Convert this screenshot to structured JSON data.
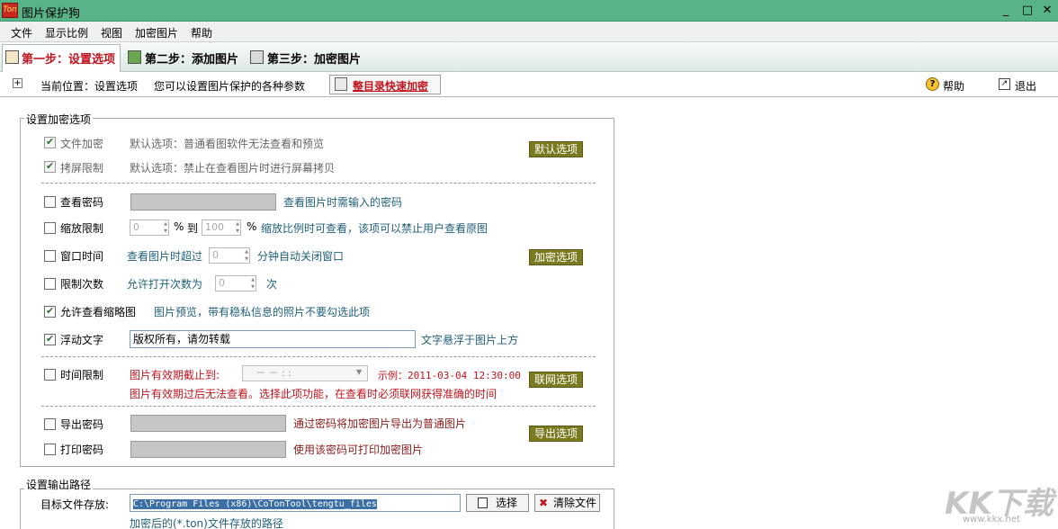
{
  "window": {
    "icon_text": "Ton",
    "title": "图片保护狗",
    "controls": [
      "_",
      "□",
      "✕"
    ]
  },
  "menu": [
    "文件",
    "显示比例",
    "视图",
    "加密图片",
    "帮助"
  ],
  "steps": [
    {
      "label": "第一步：设置选项",
      "active": true
    },
    {
      "label": "第二步：添加图片",
      "active": false
    },
    {
      "label": "第三步：加密图片",
      "active": false
    }
  ],
  "location": {
    "current": "当前位置：设置选项",
    "description": "您可以设置图片保护的各种参数",
    "whole_dir_button": "整目录快速加密",
    "help": "帮助",
    "exit": "退出"
  },
  "encrypt_group": {
    "legend": "设置加密选项",
    "file_encrypt": {
      "label": "文件加密",
      "checked": true,
      "desc": "默认选项：普通看图软件无法查看和预览"
    },
    "screen_limit": {
      "label": "拷屏限制",
      "checked": true,
      "desc": "默认选项：禁止在查看图片时进行屏幕拷贝"
    },
    "default_options_button": "默认选项",
    "view_password": {
      "label": "查看密码",
      "checked": false,
      "hint": "查看图片时需输入的密码"
    },
    "zoom_limit": {
      "label": "缩放限制",
      "checked": false,
      "from": "0",
      "percent": "%",
      "to_label": "到",
      "to": "100",
      "hint": "缩放比例时可查看，该项可以禁止用户查看原图"
    },
    "window_time": {
      "label": "窗口时间",
      "checked": false,
      "prefix": "查看图片时超过",
      "value": "0",
      "suffix": "分钟自动关闭窗口"
    },
    "encrypt_options_button": "加密选项",
    "limit_count": {
      "label": "限制次数",
      "checked": false,
      "prefix": "允许打开次数为",
      "value": "0",
      "suffix": "次"
    },
    "thumbnail": {
      "label": "允许查看缩略图",
      "checked": true,
      "hint": "图片预览，带有稳私信息的照片不要勾选此项"
    },
    "float_text": {
      "label": "浮动文字",
      "checked": true,
      "value": "版权所有，请勿转载",
      "hint": "文字悬浮于图片上方"
    },
    "time_limit": {
      "label": "时间限制",
      "checked": false,
      "prefix": "图片有效期截止到:",
      "date_value": "－ －      :   :",
      "example": "示例：2011-03-04 12:30:00",
      "note": "图片有效期过后无法查看。选择此项功能，在查看时必须联网获得准确的时间"
    },
    "network_options_button": "联网选项",
    "export_password": {
      "label": "导出密码",
      "checked": false,
      "hint": "通过密码将加密图片导出为普通图片"
    },
    "print_password": {
      "label": "打印密码",
      "checked": false,
      "hint": "使用该密码可打印加密图片"
    },
    "export_options_button": "导出选项"
  },
  "output_group": {
    "legend": "设置输出路径",
    "target_label": "目标文件存放:",
    "path": "C:\\Program Files (x86)\\CoTonTool\\tengtu_files",
    "select_button": "选择",
    "clear_button": "清除文件",
    "note": "加密后的(*.ton)文件存放的路径"
  },
  "watermark": {
    "text": "KK下载",
    "url": "www.kkx.net"
  }
}
